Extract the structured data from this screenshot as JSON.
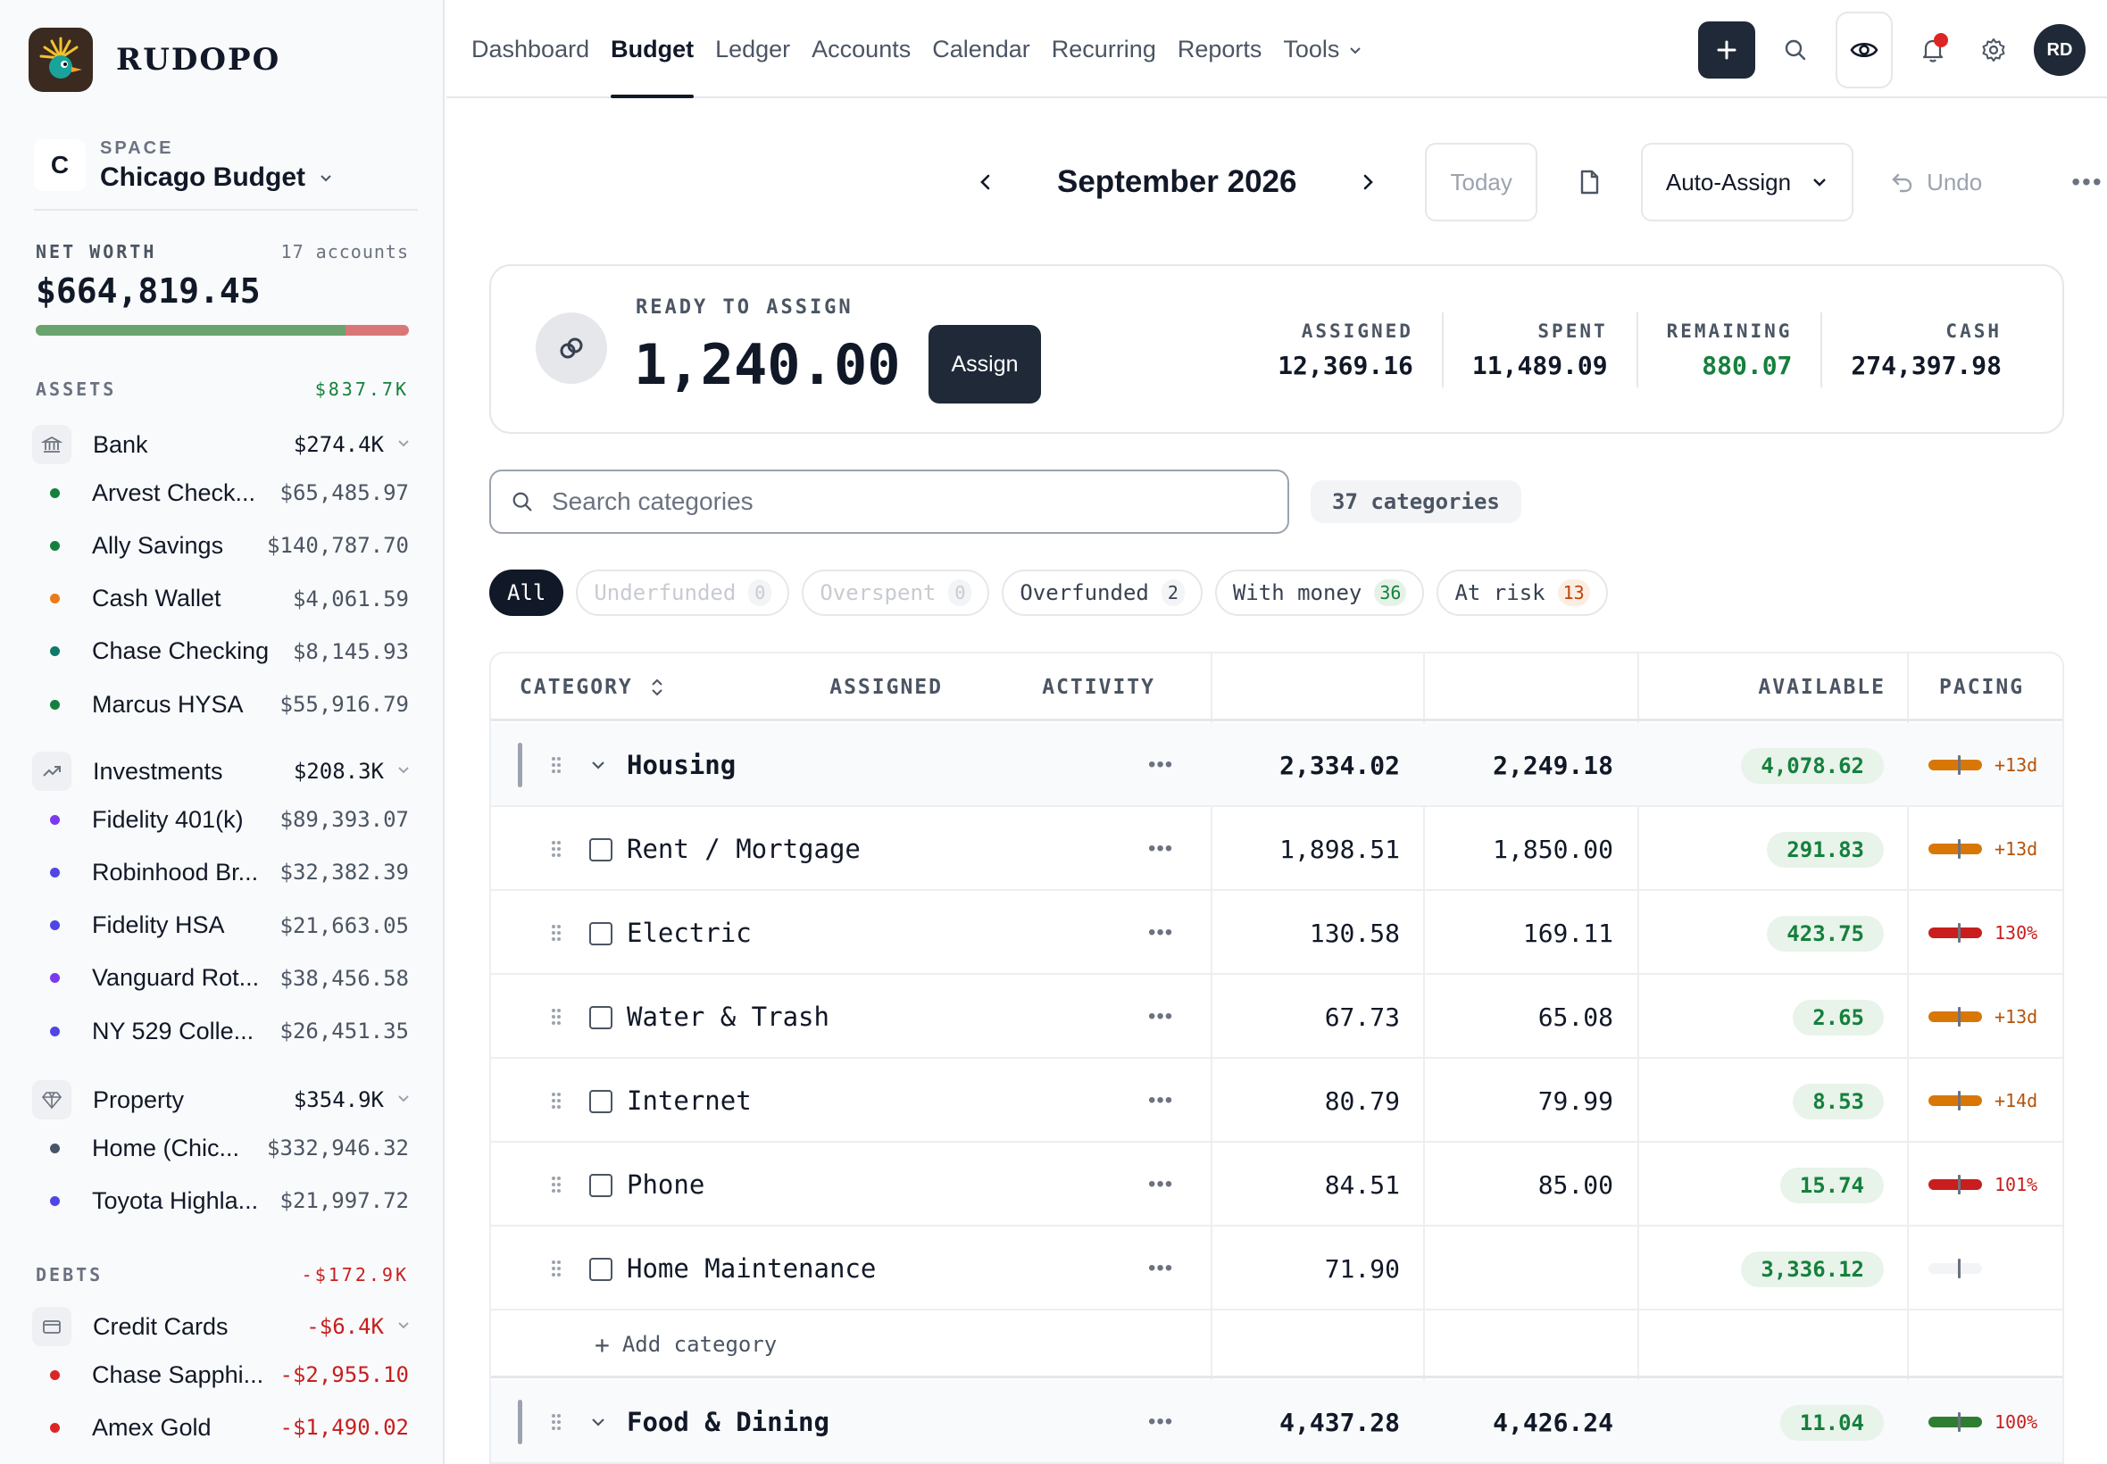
{
  "app": {
    "name": "RUDOPO"
  },
  "space": {
    "badge": "C",
    "label": "SPACE",
    "name": "Chicago Budget"
  },
  "net_worth": {
    "label": "NET WORTH",
    "count": "17 accounts",
    "value": "$664,819.45",
    "asset_share": 0.83
  },
  "assets": {
    "label": "ASSETS",
    "total": "$837.7K",
    "groups": [
      {
        "name": "Bank",
        "value": "$274.4K",
        "icon": "bank-icon",
        "accounts": [
          {
            "name": "Arvest Check...",
            "value": "$65,485.97",
            "color": "#15803d"
          },
          {
            "name": "Ally Savings",
            "value": "$140,787.70",
            "color": "#15803d"
          },
          {
            "name": "Cash Wallet",
            "value": "$4,061.59",
            "color": "#ea7a1a"
          },
          {
            "name": "Chase Checking",
            "value": "$8,145.93",
            "color": "#0f7a6a"
          },
          {
            "name": "Marcus HYSA",
            "value": "$55,916.79",
            "color": "#15803d"
          }
        ]
      },
      {
        "name": "Investments",
        "value": "$208.3K",
        "icon": "trend-up-icon",
        "accounts": [
          {
            "name": "Fidelity 401(k)",
            "value": "$89,393.07",
            "color": "#7c3aed"
          },
          {
            "name": "Robinhood Br...",
            "value": "$32,382.39",
            "color": "#4f46e5"
          },
          {
            "name": "Fidelity HSA",
            "value": "$21,663.05",
            "color": "#4f46e5"
          },
          {
            "name": "Vanguard Rot...",
            "value": "$38,456.58",
            "color": "#7c3aed"
          },
          {
            "name": "NY 529 Colle...",
            "value": "$26,451.35",
            "color": "#4f46e5"
          }
        ]
      },
      {
        "name": "Property",
        "value": "$354.9K",
        "icon": "diamond-icon",
        "accounts": [
          {
            "name": "Home (Chic...",
            "value": "$332,946.32",
            "color": "#475569"
          },
          {
            "name": "Toyota Highla...",
            "value": "$21,997.72",
            "color": "#4f46e5"
          }
        ]
      }
    ]
  },
  "debts": {
    "label": "DEBTS",
    "total": "-$172.9K",
    "groups": [
      {
        "name": "Credit Cards",
        "value": "-$6.4K",
        "icon": "credit-card-icon",
        "accounts": [
          {
            "name": "Chase Sapphi...",
            "value": "-$2,955.10",
            "color": "#dc2626"
          },
          {
            "name": "Amex Gold",
            "value": "-$1,490.02",
            "color": "#dc2626"
          }
        ]
      }
    ]
  },
  "nav": {
    "items": [
      "Dashboard",
      "Budget",
      "Ledger",
      "Accounts",
      "Calendar",
      "Recurring",
      "Reports",
      "Tools"
    ],
    "active": "Budget",
    "avatar": "RD"
  },
  "month_bar": {
    "month": "September 2026",
    "today": "Today",
    "auto_assign": "Auto-Assign",
    "undo": "Undo"
  },
  "ready": {
    "label": "READY TO ASSIGN",
    "value": "1,240.00",
    "assign_btn": "Assign",
    "stats": [
      {
        "label": "ASSIGNED",
        "value": "12,369.16",
        "color": "#111827"
      },
      {
        "label": "SPENT",
        "value": "11,489.09",
        "color": "#111827"
      },
      {
        "label": "REMAINING",
        "value": "880.07",
        "color": "#15803d"
      },
      {
        "label": "CASH",
        "value": "274,397.98",
        "color": "#111827"
      }
    ]
  },
  "search": {
    "placeholder": "Search categories",
    "count": "37 categories"
  },
  "filters": [
    {
      "label": "All",
      "count": "",
      "state": "active"
    },
    {
      "label": "Underfunded",
      "count": "0",
      "state": "muted"
    },
    {
      "label": "Overspent",
      "count": "0",
      "state": "muted"
    },
    {
      "label": "Overfunded",
      "count": "2",
      "state": "normal"
    },
    {
      "label": "With money",
      "count": "36",
      "state": "green"
    },
    {
      "label": "At risk",
      "count": "13",
      "state": "orange"
    }
  ],
  "table": {
    "headers": {
      "category": "CATEGORY",
      "assigned": "ASSIGNED",
      "activity": "ACTIVITY",
      "available": "AVAILABLE",
      "pacing": "PACING"
    },
    "add_category": "Add category",
    "rows": [
      {
        "type": "group",
        "name": "Housing",
        "assigned": "2,334.02",
        "activity": "2,249.18",
        "available": "4,078.62",
        "pace_color": "#d97706",
        "pace_label": "+13d",
        "pace_label_color": "#b45309"
      },
      {
        "type": "item",
        "name": "Rent / Mortgage",
        "assigned": "1,898.51",
        "activity": "1,850.00",
        "available": "291.83",
        "pace_color": "#d97706",
        "pace_label": "+13d",
        "pace_label_color": "#b45309"
      },
      {
        "type": "item",
        "name": "Electric",
        "assigned": "130.58",
        "activity": "169.11",
        "available": "423.75",
        "pace_color": "#c81e1e",
        "pace_label": "130%",
        "pace_label_color": "#c81e1e"
      },
      {
        "type": "item",
        "name": "Water & Trash",
        "assigned": "67.73",
        "activity": "65.08",
        "available": "2.65",
        "pace_color": "#d97706",
        "pace_label": "+13d",
        "pace_label_color": "#b45309"
      },
      {
        "type": "item",
        "name": "Internet",
        "assigned": "80.79",
        "activity": "79.99",
        "available": "8.53",
        "pace_color": "#d97706",
        "pace_label": "+14d",
        "pace_label_color": "#b45309"
      },
      {
        "type": "item",
        "name": "Phone",
        "assigned": "84.51",
        "activity": "85.00",
        "available": "15.74",
        "pace_color": "#c81e1e",
        "pace_label": "101%",
        "pace_label_color": "#c81e1e"
      },
      {
        "type": "item",
        "name": "Home Maintenance",
        "assigned": "71.90",
        "activity": "",
        "available": "3,336.12",
        "pace_color": "#f3f4f6",
        "pace_label": "",
        "pace_label_color": "#9ca3af"
      },
      {
        "type": "add"
      },
      {
        "type": "group",
        "name": "Food & Dining",
        "assigned": "4,437.28",
        "activity": "4,426.24",
        "available": "11.04",
        "pace_color": "#2f7d32",
        "pace_label": "100%",
        "pace_label_color": "#c81e1e"
      }
    ]
  }
}
